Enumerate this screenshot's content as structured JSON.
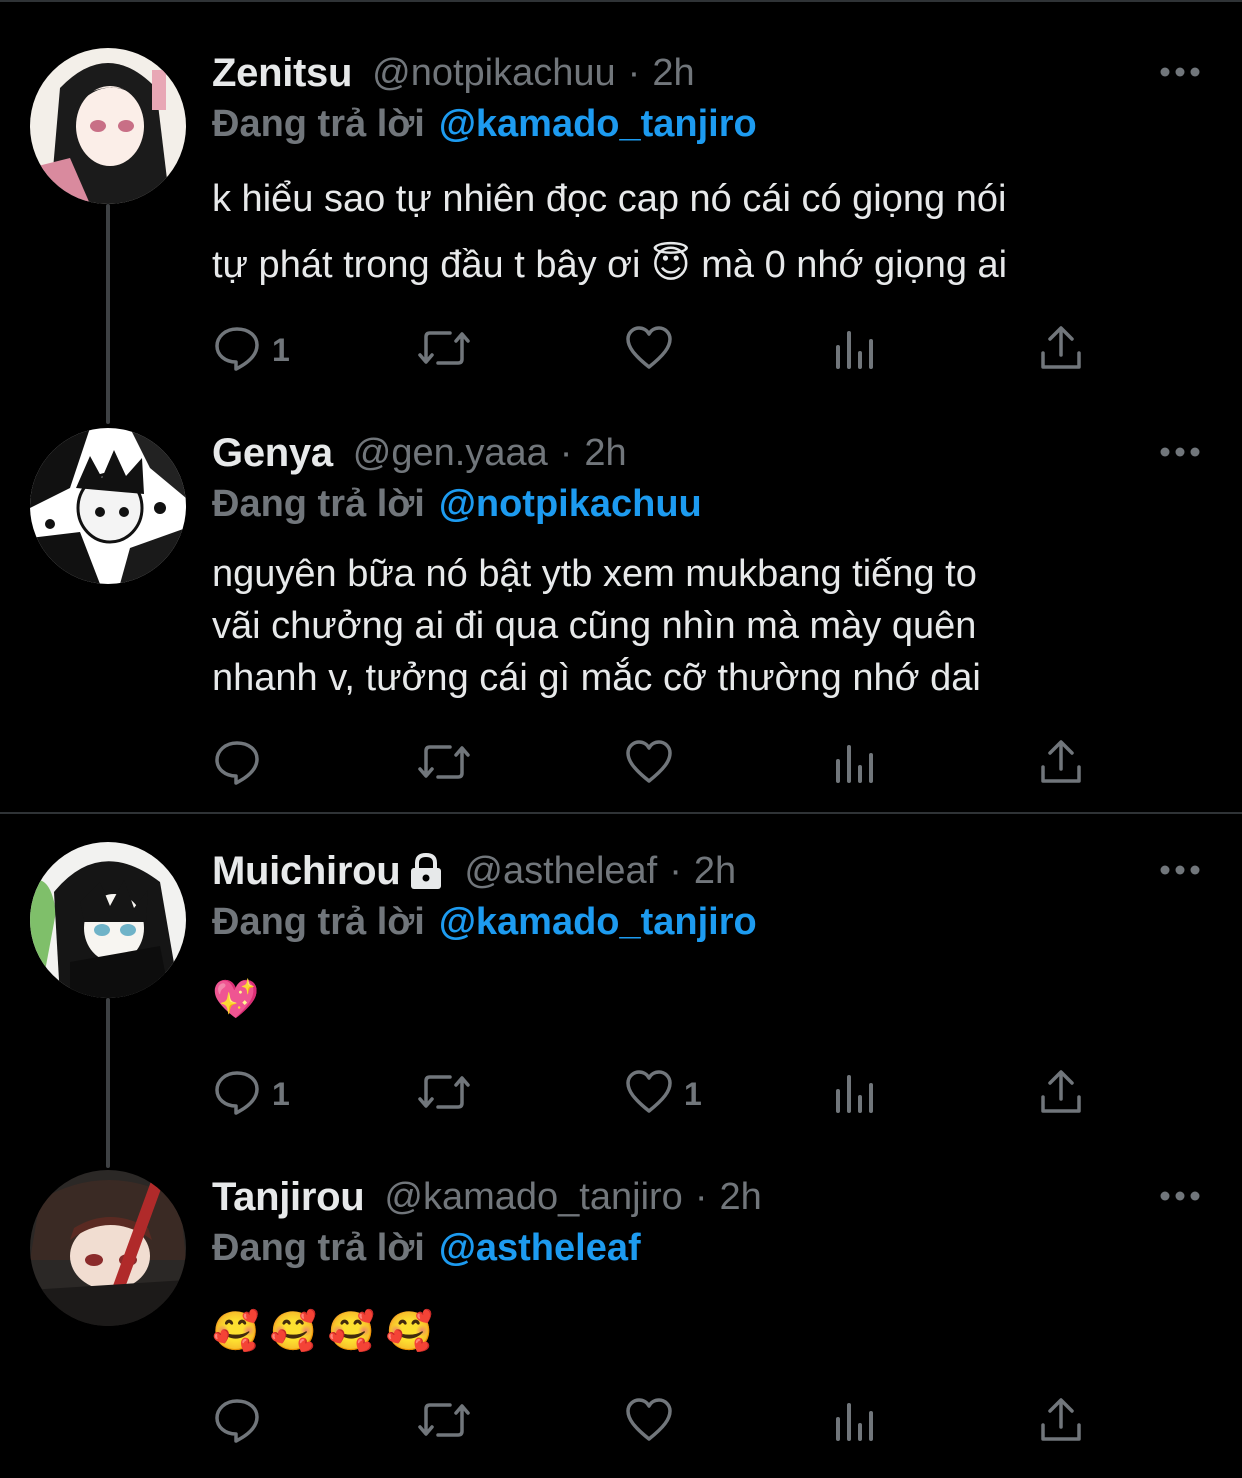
{
  "tweets": [
    {
      "name": "Zenitsu",
      "handle": "@notpikachuu",
      "separator": "·",
      "time": "2h",
      "replying_label": "Đang trả lời",
      "replying_to": "@kamado_tanjiro",
      "text_lines": [
        "k hiểu sao tự nhiên đọc cap nó cái có giọng nói",
        "tự phát trong đầu t bây ơi 😇  mà 0 nhớ giọng ai"
      ],
      "replies": "1",
      "likes": ""
    },
    {
      "name": "Genya",
      "handle": "@gen.yaaa",
      "separator": "·",
      "time": "2h",
      "replying_label": "Đang trả lời",
      "replying_to": "@notpikachuu",
      "text_lines": [
        "nguyên bữa nó bật ytb xem mukbang tiếng to",
        "vãi chưởng ai đi qua cũng nhìn mà mày quên",
        "nhanh v, tưởng cái gì mắc cỡ thường nhớ dai"
      ],
      "replies": "",
      "likes": ""
    },
    {
      "name": "Muichirou",
      "handle": "@astheleaf",
      "separator": "·",
      "time": "2h",
      "replying_label": "Đang trả lời",
      "replying_to": "@kamado_tanjiro",
      "text_lines": [
        "💖"
      ],
      "replies": "1",
      "likes": "1"
    },
    {
      "name": "Tanjirou",
      "handle": "@kamado_tanjiro",
      "separator": "·",
      "time": "2h",
      "replying_label": "Đang trả lời",
      "replying_to": "@astheleaf",
      "text_lines": [
        "🥰 🥰 🥰 🥰"
      ],
      "replies": "",
      "likes": ""
    }
  ],
  "icons": {
    "more": "more-icon",
    "lock": "lock-icon",
    "reply": "reply-icon",
    "retweet": "retweet-icon",
    "like": "like-icon",
    "views": "views-icon",
    "share": "share-icon"
  },
  "colors": {
    "background": "#000000",
    "text": "#e7e9ea",
    "muted": "#71767b",
    "accent": "#1d9bf0",
    "divider": "#2f3336"
  }
}
